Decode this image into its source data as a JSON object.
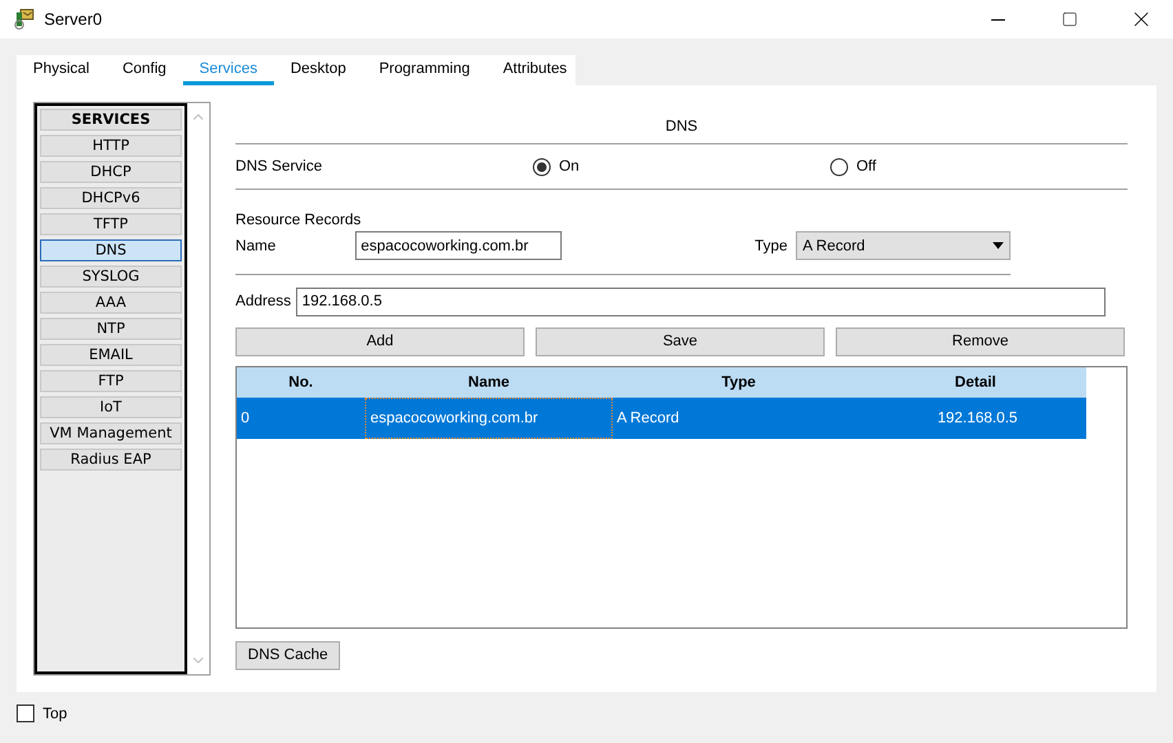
{
  "window": {
    "title": "Server0"
  },
  "tabs": [
    {
      "label": "Physical",
      "selected": false
    },
    {
      "label": "Config",
      "selected": false
    },
    {
      "label": "Services",
      "selected": true
    },
    {
      "label": "Desktop",
      "selected": false
    },
    {
      "label": "Programming",
      "selected": false
    },
    {
      "label": "Attributes",
      "selected": false
    }
  ],
  "sidebar": {
    "header": "SERVICES",
    "items": [
      {
        "label": "HTTP",
        "selected": false
      },
      {
        "label": "DHCP",
        "selected": false
      },
      {
        "label": "DHCPv6",
        "selected": false
      },
      {
        "label": "TFTP",
        "selected": false
      },
      {
        "label": "DNS",
        "selected": true
      },
      {
        "label": "SYSLOG",
        "selected": false
      },
      {
        "label": "AAA",
        "selected": false
      },
      {
        "label": "NTP",
        "selected": false
      },
      {
        "label": "EMAIL",
        "selected": false
      },
      {
        "label": "FTP",
        "selected": false
      },
      {
        "label": "IoT",
        "selected": false
      },
      {
        "label": "VM Management",
        "selected": false
      },
      {
        "label": "Radius EAP",
        "selected": false
      }
    ]
  },
  "dns": {
    "title": "DNS",
    "service_label": "DNS Service",
    "service_options": [
      {
        "label": "On",
        "selected": true
      },
      {
        "label": "Off",
        "selected": false
      }
    ],
    "records_label": "Resource Records",
    "name_label": "Name",
    "name_value": "espacocoworking.com.br",
    "type_label": "Type",
    "type_value": "A Record",
    "address_label": "Address",
    "address_value": "192.168.0.5",
    "buttons": [
      "Add",
      "Save",
      "Remove"
    ],
    "table": {
      "columns": [
        "No.",
        "Name",
        "Type",
        "Detail"
      ],
      "rows": [
        {
          "cells": [
            "0",
            "espacocoworking.com.br",
            "A Record",
            "192.168.0.5"
          ],
          "selected": true
        }
      ]
    },
    "cache_button": "DNS Cache"
  },
  "top_checkbox": {
    "label": "Top",
    "checked": false
  }
}
